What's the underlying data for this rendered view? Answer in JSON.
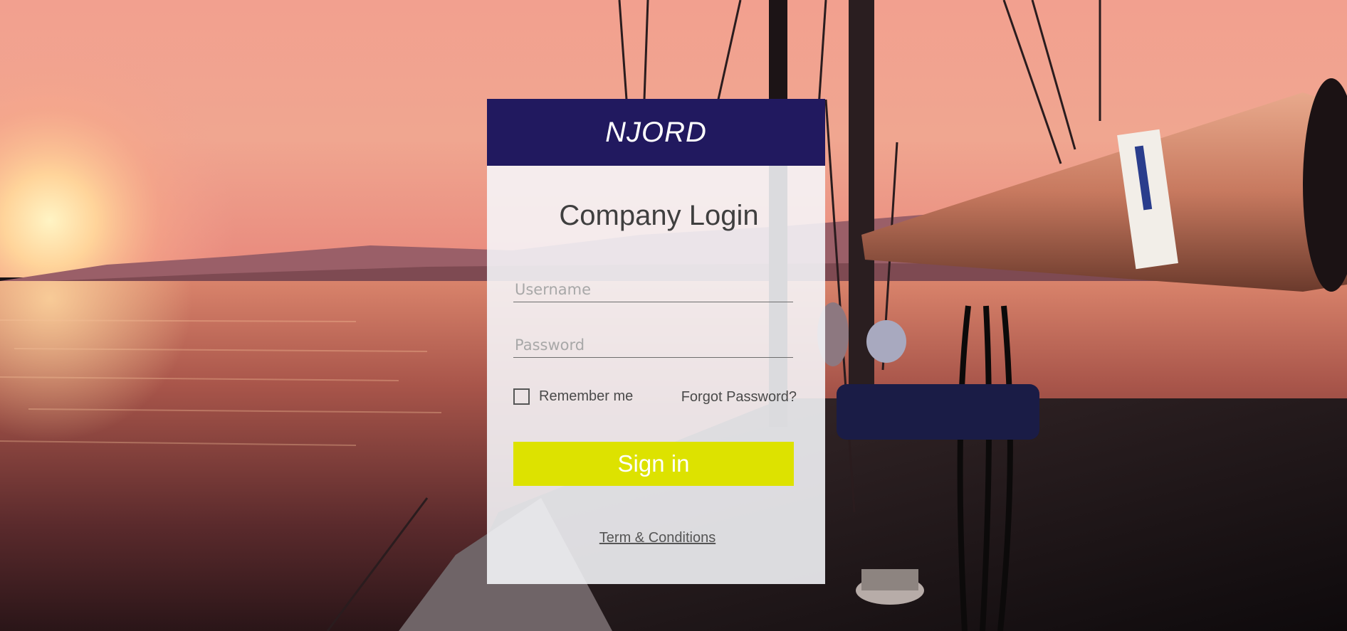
{
  "brand": {
    "name": "NJORD"
  },
  "login": {
    "title": "Company Login",
    "username_placeholder": "Username",
    "password_placeholder": "Password",
    "remember_label": "Remember me",
    "forgot_label": "Forgot Password?",
    "signin_label": "Sign in",
    "terms_label": "Term & Conditions"
  },
  "colors": {
    "header": "#21195f",
    "signin_button": "#dde200"
  },
  "icons": {
    "background": "sailboat-sunset-photo",
    "remember": "checkbox-icon"
  }
}
